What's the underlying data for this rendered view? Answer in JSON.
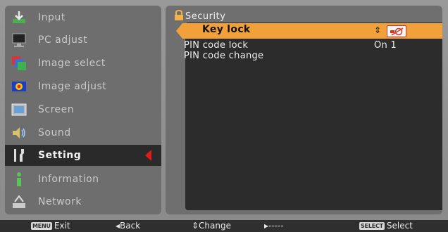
{
  "menu": {
    "items": [
      {
        "label": "Input",
        "icon": "input-icon"
      },
      {
        "label": "PC adjust",
        "icon": "pc-adjust-icon"
      },
      {
        "label": "Image select",
        "icon": "image-select-icon"
      },
      {
        "label": "Image adjust",
        "icon": "image-adjust-icon"
      },
      {
        "label": "Screen",
        "icon": "screen-icon"
      },
      {
        "label": "Sound",
        "icon": "sound-icon"
      },
      {
        "label": "Setting",
        "icon": "setting-icon"
      },
      {
        "label": "Information",
        "icon": "information-icon"
      },
      {
        "label": "Network",
        "icon": "network-icon"
      }
    ],
    "selected": "Setting"
  },
  "panel": {
    "title": "Security",
    "title_icon": "lock-icon",
    "rows": [
      {
        "label": "Key lock",
        "value_icon": "key-lock-off-icon",
        "updown": "⇕"
      },
      {
        "label": "PIN code lock",
        "value": "On 1"
      },
      {
        "label": "PIN code change"
      }
    ]
  },
  "footer": {
    "exit_key": "MENU",
    "exit_label": "Exit",
    "back_label": "◂Back",
    "change_label": "⇕Change",
    "next_label": "▸-----",
    "select_key": "SELECT",
    "select_label": "Select"
  },
  "colors": {
    "highlight": "#f2a13a",
    "active_arrow": "#e21a1a",
    "panel_dark": "#2c2c2c"
  }
}
